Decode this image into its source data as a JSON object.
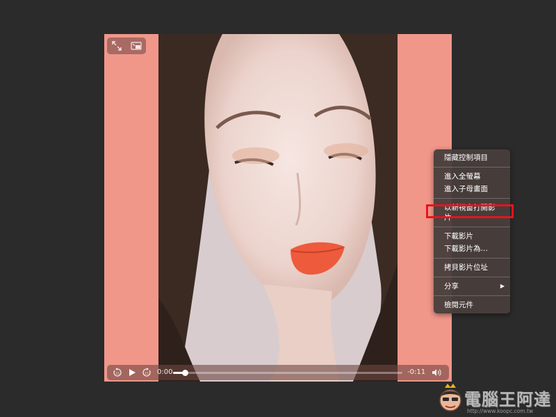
{
  "player": {
    "current_time": "0:00",
    "remaining_time": "-0:11",
    "progress": 0.05
  },
  "context_menu": {
    "groups": [
      [
        "隱藏控制項目"
      ],
      [
        "進入全螢幕",
        "進入子母畫面"
      ],
      [
        "以新視窗打開影片"
      ],
      [
        "下載影片",
        "下載影片為…"
      ],
      [
        "拷貝影片位址"
      ],
      [
        "分享"
      ],
      [
        "檢閱元件"
      ]
    ],
    "highlighted_item": "下載影片",
    "submenu_items": [
      "分享"
    ]
  },
  "watermark": {
    "title": "電腦王阿達",
    "url": "http://www.koopc.com.tw"
  },
  "colors": {
    "page_background": "#2b2b2b",
    "video_background": "#f0978a",
    "highlight": "#e8141c",
    "menu_background": "#483e3c"
  }
}
